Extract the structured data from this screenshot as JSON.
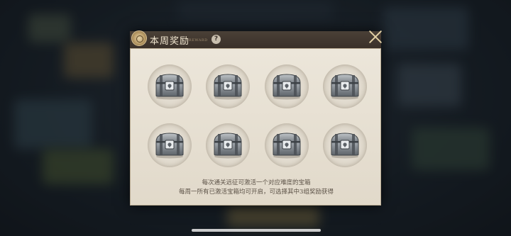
{
  "modal": {
    "title": "本周奖励",
    "subtitle": "REWARD",
    "help_label": "?",
    "description_line1": "每次通关远征可激活一个对应难度的宝箱",
    "description_line2": "每周一所有已激活宝箱均可开启，可选择其中3组奖励获得"
  },
  "chests": [
    {
      "state": "locked",
      "icon": "silver-chest-icon"
    },
    {
      "state": "locked",
      "icon": "silver-chest-icon"
    },
    {
      "state": "locked",
      "icon": "silver-chest-icon"
    },
    {
      "state": "locked",
      "icon": "silver-chest-icon"
    },
    {
      "state": "locked",
      "icon": "silver-chest-icon"
    },
    {
      "state": "locked",
      "icon": "silver-chest-icon"
    },
    {
      "state": "locked",
      "icon": "silver-chest-icon"
    },
    {
      "state": "locked",
      "icon": "silver-chest-icon"
    }
  ],
  "colors": {
    "header": "#3a3029",
    "panel": "#e6dfd2",
    "accent": "#e3d1a6"
  }
}
